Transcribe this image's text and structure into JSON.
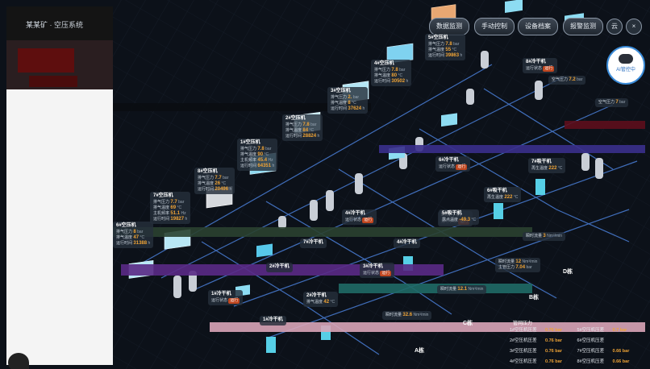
{
  "nav": {
    "title": "某某矿 · 空压系统",
    "buttons": [
      "数据监测",
      "手动控制",
      "设备档案",
      "报警监测"
    ],
    "icon_button": "云"
  },
  "ai_badge": {
    "label": "AI管控中",
    "icon": "robot-face-icon"
  },
  "units": {
    "pressure": "bar",
    "temp": "°C",
    "time": "h",
    "flow": "Nm³/min"
  },
  "compressors": [
    {
      "name": "5#空压机",
      "rows": [
        {
          "label": "排气压力",
          "value": "7.8",
          "unit": "bar"
        },
        {
          "label": "排气温度",
          "value": "55",
          "unit": "°C"
        },
        {
          "label": "运行时间",
          "value": "39863",
          "unit": "h"
        }
      ]
    },
    {
      "name": "4#空压机",
      "rows": [
        {
          "label": "排气压力",
          "value": "7.8",
          "unit": "bar"
        },
        {
          "label": "排气温度",
          "value": "80",
          "unit": "°C"
        },
        {
          "label": "运行时间",
          "value": "30502",
          "unit": "h"
        }
      ]
    },
    {
      "name": "3#空压机",
      "rows": [
        {
          "label": "排气压力",
          "value": "2.",
          "unit": "bar"
        },
        {
          "label": "排气温度",
          "value": "8",
          "unit": "°C"
        },
        {
          "label": "运行时间",
          "value": "37624",
          "unit": "h"
        }
      ]
    },
    {
      "name": "2#空压机",
      "rows": [
        {
          "label": "排气压力",
          "value": "7.8",
          "unit": "bar"
        },
        {
          "label": "排气温度",
          "value": "84",
          "unit": "°C"
        },
        {
          "label": "运行时间",
          "value": "28824",
          "unit": "h"
        }
      ]
    },
    {
      "name": "1#空压机",
      "rows": [
        {
          "label": "排气压力",
          "value": "7.8",
          "unit": "bar"
        },
        {
          "label": "排气温度",
          "value": "90",
          "unit": "°C"
        },
        {
          "label": "主机频率",
          "value": "45.4",
          "unit": "Hz"
        },
        {
          "label": "运行时间",
          "value": "64351",
          "unit": "h"
        }
      ]
    },
    {
      "name": "8#空压机",
      "rows": [
        {
          "label": "排气压力",
          "value": "7.7",
          "unit": "bar"
        },
        {
          "label": "排气温度",
          "value": "26",
          "unit": "°C"
        },
        {
          "label": "运行时间",
          "value": "20496",
          "unit": "h"
        }
      ]
    },
    {
      "name": "7#空压机",
      "rows": [
        {
          "label": "排气压力",
          "value": "7.7",
          "unit": "bar"
        },
        {
          "label": "排气温度",
          "value": "69",
          "unit": "°C"
        },
        {
          "label": "主机频率",
          "value": "51.1",
          "unit": "Hz"
        },
        {
          "label": "运行时间",
          "value": "19827",
          "unit": "h"
        }
      ]
    },
    {
      "name": "6#空压机",
      "rows": [
        {
          "label": "排气压力",
          "value": "8",
          "unit": "bar"
        },
        {
          "label": "排气温度",
          "value": "47",
          "unit": "°C"
        },
        {
          "label": "运行时间",
          "value": "31388",
          "unit": "h"
        }
      ]
    }
  ],
  "dryers": [
    {
      "name": "8#冷干机",
      "rows": [
        {
          "label": "运行状态",
          "status": "运行"
        }
      ]
    },
    {
      "name": "4#冷干机",
      "rows": [
        {
          "label": "运行状态",
          "status": "运行"
        }
      ]
    },
    {
      "name": "5#冷干机",
      "rows": [
        {
          "label": "运行状态",
          "status": "运行"
        }
      ]
    },
    {
      "name": "6#冷干机",
      "rows": [
        {
          "label": "运行状态",
          "status": "运行"
        }
      ]
    },
    {
      "name": "7#吸干机",
      "rows": [
        {
          "label": "再生温度",
          "value": "222",
          "unit": "°C"
        }
      ]
    },
    {
      "name": "6#吸干机",
      "rows": [
        {
          "label": "再生温度",
          "value": "222",
          "unit": "°C"
        }
      ]
    },
    {
      "name": "5#吸干机",
      "rows": [
        {
          "label": "露点温度",
          "value": "-49.3",
          "unit": "°C"
        }
      ]
    },
    {
      "name": "7#冷干机",
      "rows": []
    },
    {
      "name": "4#冷干机",
      "rows": []
    },
    {
      "name": "3#冷干机",
      "rows": [
        {
          "label": "运行状态",
          "status": "运行"
        }
      ]
    },
    {
      "name": "2#冷干机",
      "rows": []
    },
    {
      "name": "2#冷干机",
      "rows": [
        {
          "label": "排气温度",
          "value": "42",
          "unit": "°C"
        }
      ]
    },
    {
      "name": "1#冷干机",
      "rows": [
        {
          "label": "运行状态",
          "status": "运行"
        }
      ]
    },
    {
      "name": "1#冷干机",
      "rows": []
    }
  ],
  "pipeline": {
    "header_pressure": {
      "label": "空气压力",
      "value": "7.2",
      "unit": "bar"
    },
    "right_pressure": {
      "label": "空气压力",
      "value": "7",
      "unit": "bar"
    },
    "flow_top": {
      "label": "瞬时流量",
      "value": "3",
      "unit": "Nm³/min"
    },
    "flow_mid": {
      "label": "瞬时流量",
      "value": "12",
      "unit": "Nm³/min"
    },
    "main_pressure": {
      "label": "主管压力",
      "value": "7.04",
      "unit": "bar"
    },
    "flow_b": {
      "label": "瞬时流量",
      "value": "12.1",
      "unit": "Nm³/min"
    },
    "flow_a": {
      "label": "瞬时流量",
      "value": "32.6",
      "unit": "Nm³/min"
    }
  },
  "buildings": [
    "A栋",
    "B栋",
    "C栋",
    "D栋"
  ],
  "bottom_panel": {
    "title": "管网压力",
    "rows": [
      [
        {
          "label": "1#空压机压差",
          "value": "0.76",
          "unit": "bar"
        },
        {
          "label": "5#空压机压差",
          "value": "0.7",
          "unit": "bar"
        }
      ],
      [
        {
          "label": "2#空压机压差",
          "value": "0.76",
          "unit": "bar"
        },
        {
          "label": "6#空压机压差",
          "value": "",
          "unit": ""
        }
      ],
      [
        {
          "label": "3#空压机压差",
          "value": "0.76",
          "unit": "bar"
        },
        {
          "label": "7#空压机压差",
          "value": "0.66",
          "unit": "bar"
        }
      ],
      [
        {
          "label": "4#空压机压差",
          "value": "0.76",
          "unit": "bar"
        },
        {
          "label": "8#空压机压差",
          "value": "0.66",
          "unit": "bar"
        }
      ]
    ]
  }
}
